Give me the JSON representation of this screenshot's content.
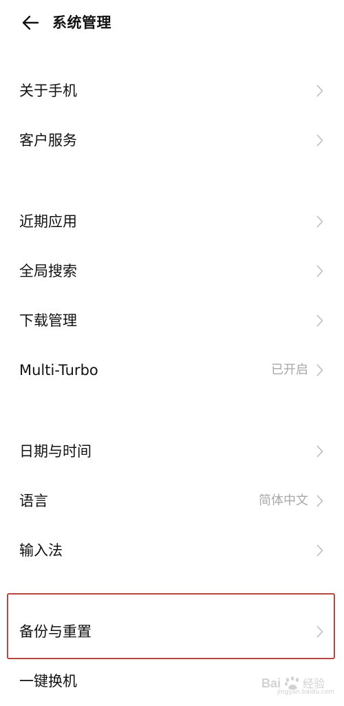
{
  "header": {
    "back_icon": "arrow-left-icon",
    "title": "系统管理"
  },
  "groups": [
    {
      "items": [
        {
          "label": "关于手机",
          "value": "",
          "icon": "chevron-right-icon"
        },
        {
          "label": "客户服务",
          "value": "",
          "icon": "chevron-right-icon"
        }
      ]
    },
    {
      "items": [
        {
          "label": "近期应用",
          "value": "",
          "icon": "chevron-right-icon"
        },
        {
          "label": "全局搜索",
          "value": "",
          "icon": "chevron-right-icon"
        },
        {
          "label": "下载管理",
          "value": "",
          "icon": "chevron-right-icon"
        },
        {
          "label": "Multi-Turbo",
          "value": "已开启",
          "icon": "chevron-right-icon"
        }
      ]
    },
    {
      "items": [
        {
          "label": "日期与时间",
          "value": "",
          "icon": "chevron-right-icon"
        },
        {
          "label": "语言",
          "value": "简体中文",
          "icon": "chevron-right-icon"
        },
        {
          "label": "输入法",
          "value": "",
          "icon": "chevron-right-icon"
        }
      ]
    },
    {
      "items": [
        {
          "label": "备份与重置",
          "value": "",
          "icon": "chevron-right-icon",
          "highlighted": true
        },
        {
          "label": "一键换机",
          "value": "",
          "icon": "chevron-right-icon"
        }
      ]
    }
  ],
  "colors": {
    "text": "#111111",
    "secondary_text": "#a8a8a8",
    "chevron": "#c4c4c4",
    "highlight_border": "#b4473f",
    "background": "#ffffff"
  },
  "watermark": {
    "brand": "Bai",
    "brand_suffix": "经验",
    "url": "jingyan.baidu.com"
  }
}
